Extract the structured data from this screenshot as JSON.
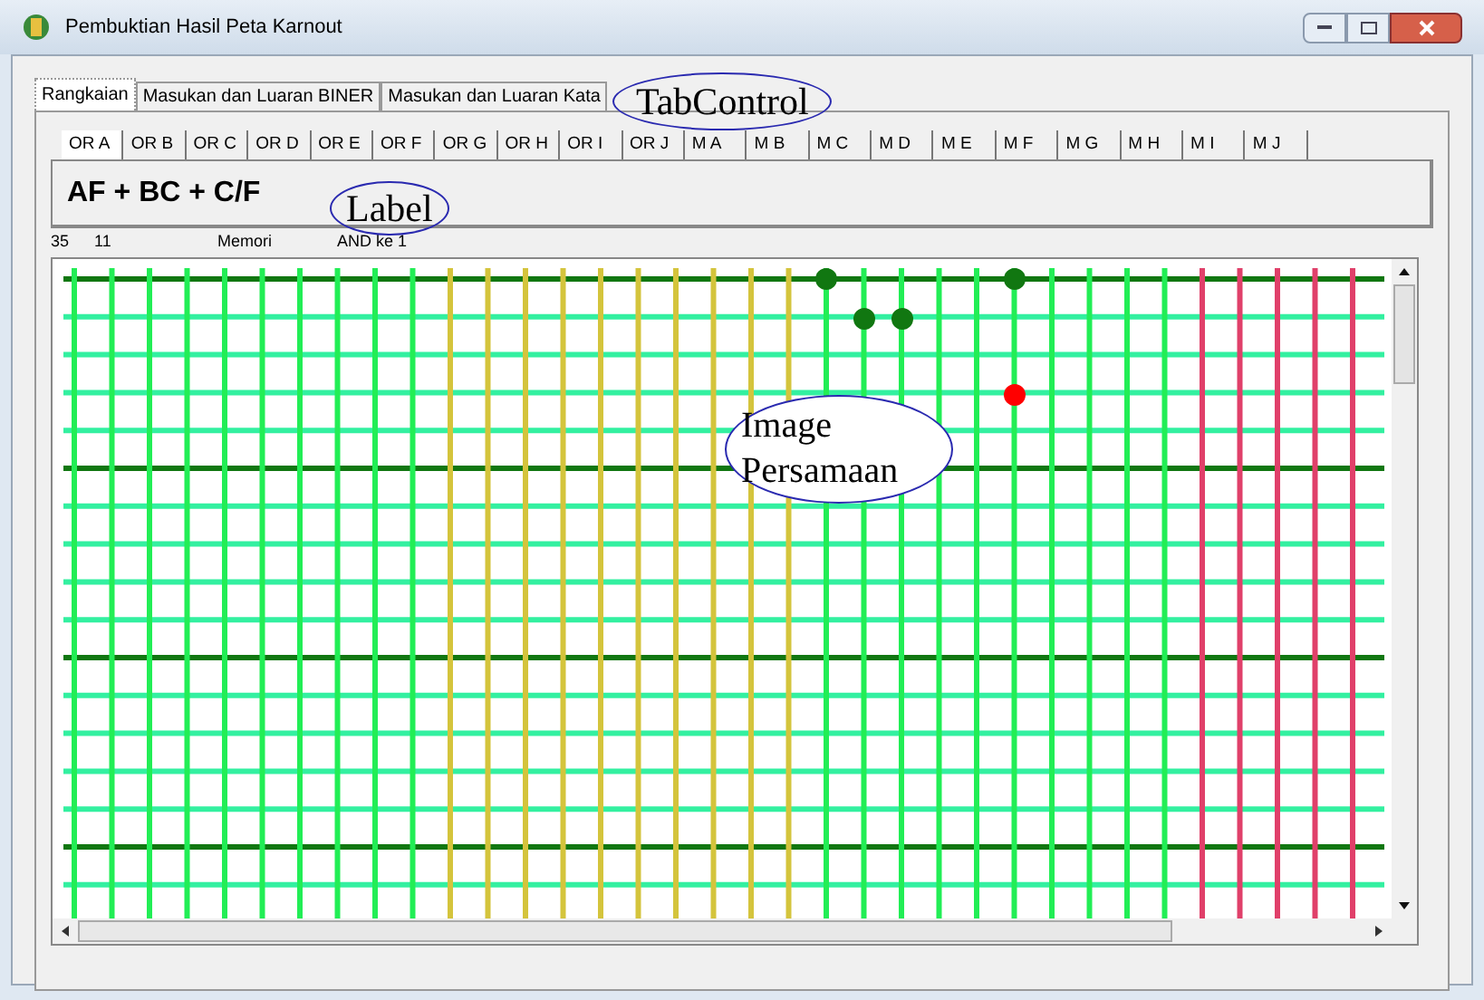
{
  "window": {
    "title": "Pembuktian Hasil Peta Karnout"
  },
  "tabs": [
    {
      "label": "Rangkaian",
      "selected": true
    },
    {
      "label": "Masukan dan Luaran BINER",
      "selected": false
    },
    {
      "label": "Masukan dan Luaran Kata",
      "selected": false
    }
  ],
  "sub_tabs": [
    {
      "label": "OR A",
      "selected": true
    },
    {
      "label": "OR B",
      "selected": false
    },
    {
      "label": "OR C",
      "selected": false
    },
    {
      "label": "OR D",
      "selected": false
    },
    {
      "label": "OR E",
      "selected": false
    },
    {
      "label": "OR F",
      "selected": false
    },
    {
      "label": "OR G",
      "selected": false
    },
    {
      "label": "OR H",
      "selected": false
    },
    {
      "label": "OR I",
      "selected": false
    },
    {
      "label": "OR J",
      "selected": false
    },
    {
      "label": "M A",
      "selected": false
    },
    {
      "label": "M B",
      "selected": false
    },
    {
      "label": "M C",
      "selected": false
    },
    {
      "label": "M D",
      "selected": false
    },
    {
      "label": "M E",
      "selected": false
    },
    {
      "label": "M F",
      "selected": false
    },
    {
      "label": "M G",
      "selected": false
    },
    {
      "label": "M H",
      "selected": false
    },
    {
      "label": "M I",
      "selected": false
    },
    {
      "label": "M J",
      "selected": false
    }
  ],
  "equation": "AF + BC + C/F",
  "status": [
    "35",
    "11",
    "Memori",
    "AND ke 1"
  ],
  "annotations": [
    {
      "text": "TabControl"
    },
    {
      "text": "Label"
    },
    {
      "text": "Image Persamaan"
    }
  ]
}
